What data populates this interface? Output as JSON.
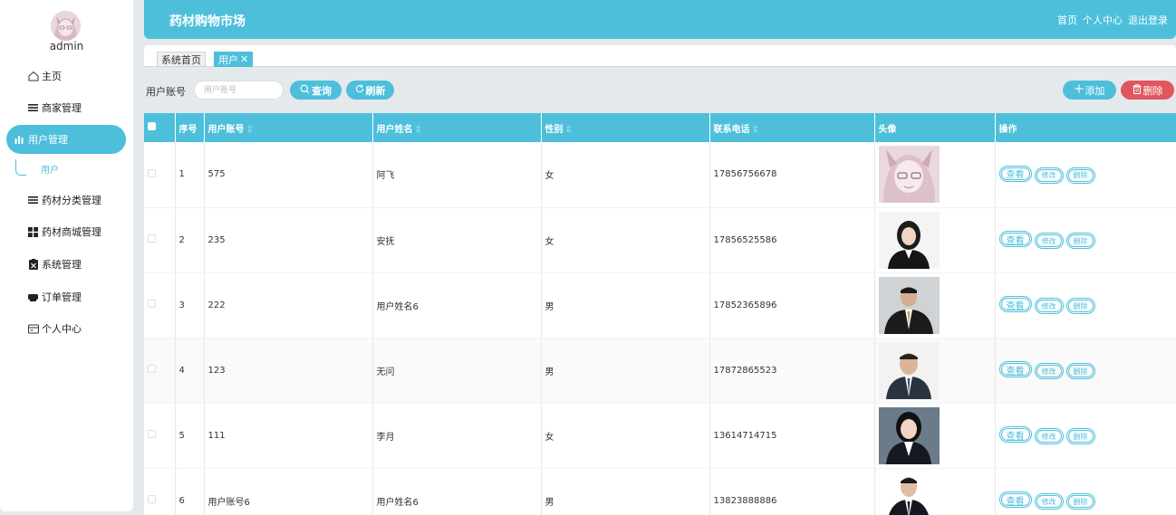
{
  "app": {
    "title": "药材购物市场"
  },
  "header_links": [
    "首页",
    "个人中心",
    "退出登录"
  ],
  "sidebar": {
    "username": "admin",
    "items": [
      {
        "label": "主页",
        "icon": "home-icon"
      },
      {
        "label": "商家管理",
        "icon": "list-icon"
      },
      {
        "label": "用户管理",
        "icon": "bar-chart-icon",
        "active": true
      },
      {
        "label": "药材分类管理",
        "icon": "list-icon"
      },
      {
        "label": "药材商城管理",
        "icon": "grid-icon"
      },
      {
        "label": "系统管理",
        "icon": "clipboard-icon"
      },
      {
        "label": "订单管理",
        "icon": "printer-icon"
      },
      {
        "label": "个人中心",
        "icon": "card-icon"
      }
    ],
    "submenu": "用户"
  },
  "tabs": {
    "home": "系统首页",
    "current": "用户",
    "close": "✕"
  },
  "toolbar": {
    "account_label": "用户账号",
    "account_placeholder": "用户账号",
    "query": "查询",
    "refresh": "刷新",
    "add": "添加",
    "delete": "删除"
  },
  "table": {
    "headers": {
      "index": "序号",
      "account": "用户账号",
      "name": "用户姓名",
      "gender": "性别",
      "phone": "联系电话",
      "avatar": "头像",
      "actions": "操作"
    },
    "sort_glyph": "⇳",
    "action_labels": {
      "view": "查看",
      "edit": "修改",
      "delete": "删除"
    },
    "rows": [
      {
        "index": "1",
        "account": "575",
        "name": "阿飞",
        "gender": "女",
        "phone": "17856756678"
      },
      {
        "index": "2",
        "account": "235",
        "name": "安抚",
        "gender": "女",
        "phone": "17856525586"
      },
      {
        "index": "3",
        "account": "222",
        "name": "用户姓名6",
        "gender": "男",
        "phone": "17852365896"
      },
      {
        "index": "4",
        "account": "123",
        "name": "无问",
        "gender": "男",
        "phone": "17872865523"
      },
      {
        "index": "5",
        "account": "111",
        "name": "李月",
        "gender": "女",
        "phone": "13614714715"
      },
      {
        "index": "6",
        "account": "用户账号6",
        "name": "用户姓名6",
        "gender": "男",
        "phone": "13823888886"
      }
    ]
  },
  "colors": {
    "primary": "#4dbfdb",
    "danger": "#e0565e",
    "background": "#e4e9ec"
  }
}
